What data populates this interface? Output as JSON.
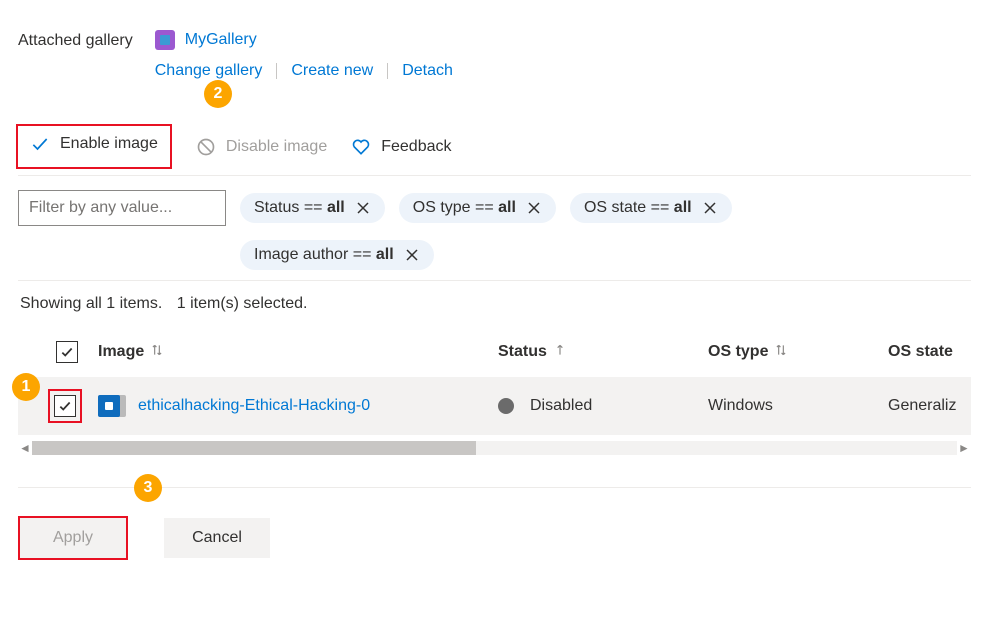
{
  "header": {
    "label": "Attached gallery",
    "gallery_name": "MyGallery",
    "actions": {
      "change": "Change gallery",
      "create": "Create new",
      "detach": "Detach"
    }
  },
  "toolbar": {
    "enable": "Enable image",
    "disable": "Disable image",
    "feedback": "Feedback"
  },
  "filters": {
    "placeholder": "Filter by any value...",
    "chips": [
      {
        "field": "Status",
        "op": "==",
        "value": "all"
      },
      {
        "field": "OS type",
        "op": "==",
        "value": "all"
      },
      {
        "field": "OS state",
        "op": "==",
        "value": "all"
      },
      {
        "field": "Image author",
        "op": "==",
        "value": "all"
      }
    ]
  },
  "summary": {
    "count": "Showing all 1 items.",
    "selected": "1 item(s) selected."
  },
  "columns": {
    "image": "Image",
    "status": "Status",
    "ostype": "OS type",
    "osstate": "OS state"
  },
  "rows": [
    {
      "name": "ethicalhacking-Ethical-Hacking-0",
      "status": "Disabled",
      "ostype": "Windows",
      "osstate": "Generaliz"
    }
  ],
  "footer": {
    "apply": "Apply",
    "cancel": "Cancel"
  },
  "annotations": {
    "a1": "1",
    "a2": "2",
    "a3": "3"
  }
}
